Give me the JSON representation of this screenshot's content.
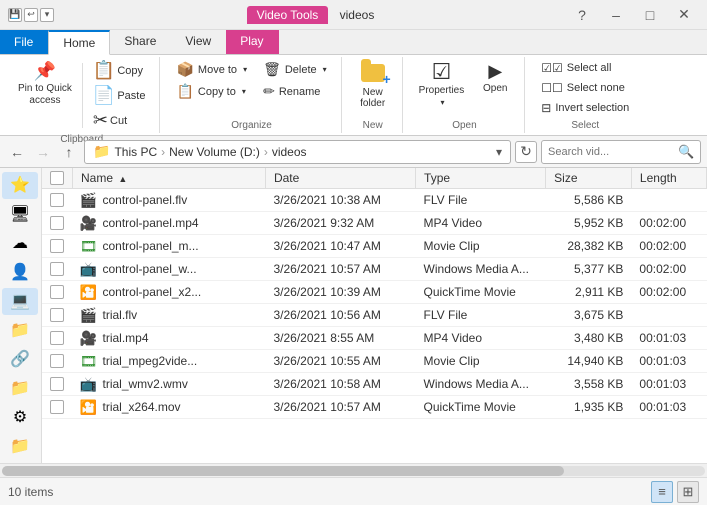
{
  "titleBar": {
    "appTitle": "videos",
    "videoToolsLabel": "Video Tools"
  },
  "ribbon": {
    "tabs": [
      "File",
      "Home",
      "Share",
      "View",
      "Play"
    ],
    "activeTab": "Home",
    "groups": {
      "clipboard": {
        "label": "Clipboard",
        "pinToQuick": "Pin to Quick\naccess",
        "copy": "Copy",
        "paste": "Paste",
        "cut": "Cut"
      },
      "organize": {
        "label": "Organize",
        "moveTo": "Move to",
        "copyTo": "Copy to",
        "delete": "Delete",
        "rename": "Rename"
      },
      "new": {
        "label": "New",
        "newFolder": "New\nfolder"
      },
      "open": {
        "label": "Open",
        "properties": "Properties",
        "openLabel": "Open"
      },
      "select": {
        "label": "Select",
        "selectAll": "Select all",
        "selectNone": "Select none",
        "invertSelection": "Invert selection"
      }
    }
  },
  "addressBar": {
    "pathParts": [
      "This PC",
      "New Volume (D:)",
      "videos"
    ],
    "searchPlaceholder": "Search vid...",
    "backDisabled": false,
    "forwardDisabled": true
  },
  "sidebar": {
    "items": [
      {
        "name": "quick-access",
        "icon": "⭐",
        "label": "Quick Access"
      },
      {
        "name": "desktop",
        "icon": "🖥",
        "label": "Desktop"
      },
      {
        "name": "cloud",
        "icon": "☁",
        "label": "OneDrive"
      },
      {
        "name": "user",
        "icon": "👤",
        "label": "User"
      },
      {
        "name": "this-pc",
        "icon": "💻",
        "label": "This PC"
      },
      {
        "name": "libraries",
        "icon": "📁",
        "label": "Libraries"
      },
      {
        "name": "network",
        "icon": "🔗",
        "label": "Network"
      },
      {
        "name": "folder2",
        "icon": "📁",
        "label": "Folder"
      },
      {
        "name": "settings",
        "icon": "⚙",
        "label": "Settings"
      },
      {
        "name": "folder3",
        "icon": "📁",
        "label": "Folder 3"
      }
    ]
  },
  "fileList": {
    "columns": [
      "Name",
      "Date",
      "Type",
      "Size",
      "Length"
    ],
    "files": [
      {
        "name": "control-panel.flv",
        "date": "3/26/2021 10:38 AM",
        "type": "FLV File",
        "size": "5,586 KB",
        "length": "",
        "iconType": "flv"
      },
      {
        "name": "control-panel.mp4",
        "date": "3/26/2021 9:32 AM",
        "type": "MP4 Video",
        "size": "5,952 KB",
        "length": "00:02:00",
        "iconType": "mp4"
      },
      {
        "name": "control-panel_m...",
        "date": "3/26/2021 10:47 AM",
        "type": "Movie Clip",
        "size": "28,382 KB",
        "length": "00:02:00",
        "iconType": "avi"
      },
      {
        "name": "control-panel_w...",
        "date": "3/26/2021 10:57 AM",
        "type": "Windows Media A...",
        "size": "5,377 KB",
        "length": "00:02:00",
        "iconType": "wmv"
      },
      {
        "name": "control-panel_x2...",
        "date": "3/26/2021 10:39 AM",
        "type": "QuickTime Movie",
        "size": "2,911 KB",
        "length": "00:02:00",
        "iconType": "mov"
      },
      {
        "name": "trial.flv",
        "date": "3/26/2021 10:56 AM",
        "type": "FLV File",
        "size": "3,675 KB",
        "length": "",
        "iconType": "flv"
      },
      {
        "name": "trial.mp4",
        "date": "3/26/2021 8:55 AM",
        "type": "MP4 Video",
        "size": "3,480 KB",
        "length": "00:01:03",
        "iconType": "mp4"
      },
      {
        "name": "trial_mpeg2vide...",
        "date": "3/26/2021 10:55 AM",
        "type": "Movie Clip",
        "size": "14,940 KB",
        "length": "00:01:03",
        "iconType": "avi"
      },
      {
        "name": "trial_wmv2.wmv",
        "date": "3/26/2021 10:58 AM",
        "type": "Windows Media A...",
        "size": "3,558 KB",
        "length": "00:01:03",
        "iconType": "wmv"
      },
      {
        "name": "trial_x264.mov",
        "date": "3/26/2021 10:57 AM",
        "type": "QuickTime Movie",
        "size": "1,935 KB",
        "length": "00:01:03",
        "iconType": "mov"
      }
    ]
  },
  "statusBar": {
    "itemCount": "10 items"
  }
}
